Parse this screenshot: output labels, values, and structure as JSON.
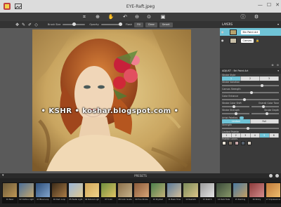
{
  "window": {
    "title": "EYE-Raft.jpeg"
  },
  "toolbar": {
    "brush_size_label": "Brush Size",
    "opacity_label": "Opacity",
    "flash_label": "Flash",
    "fill_label": "Fill",
    "clear_label": "Clear",
    "smart_label": "Smart"
  },
  "layers": {
    "title": "LAYERS",
    "items": [
      {
        "label": "Bin Paint Art",
        "selected": true
      },
      {
        "label": "Canvas",
        "selected": false
      }
    ]
  },
  "adjust": {
    "title": "ADJUST : Bri Paint Art",
    "stroke_style_label": "Stroke Style",
    "stroke_style_options": [
      "1",
      "2",
      "3"
    ],
    "stroke_variation_label": "Stroke Variation",
    "canvas_strength_label": "Canvas Strength",
    "color_enhance_label": "Color Enhance",
    "stroke_color_shift_label": "Stroke Color Shift",
    "overall_color_tone_label": "Overall Color Tone",
    "stroke_strength_label": "Stroke Strength",
    "stroke_depth_label": "Stroke Depth",
    "artist_palettes_label": "Artist Palettes",
    "palette_options": [
      "Limited",
      "Full"
    ],
    "strength_label": "Strength",
    "limited_palette_label": "Limited Palette",
    "palette_numbers": [
      "1",
      "2",
      "3",
      "4",
      "5",
      "6"
    ],
    "palette_colors_label": "Palette Colors"
  },
  "watermark": {
    "text": "• KSHR • koshar.blogspot.com •"
  },
  "presets": {
    "title": "PRESETS",
    "items": [
      "01 Basic",
      "02 Outline Light",
      "03 Blue Loop",
      "04 Dark Loop",
      "05 Pastel Light",
      "06 Natural Light",
      "07 Color",
      "08 Color Guide",
      "09 Fine Stroke",
      "10 Stylized",
      "11 Basic Tone",
      "12 Realistic",
      "13 Sketch",
      "14 Dark Fade",
      "15 Painting",
      "16 Sticky",
      "17 Impressionist",
      "18 Pastel"
    ]
  }
}
